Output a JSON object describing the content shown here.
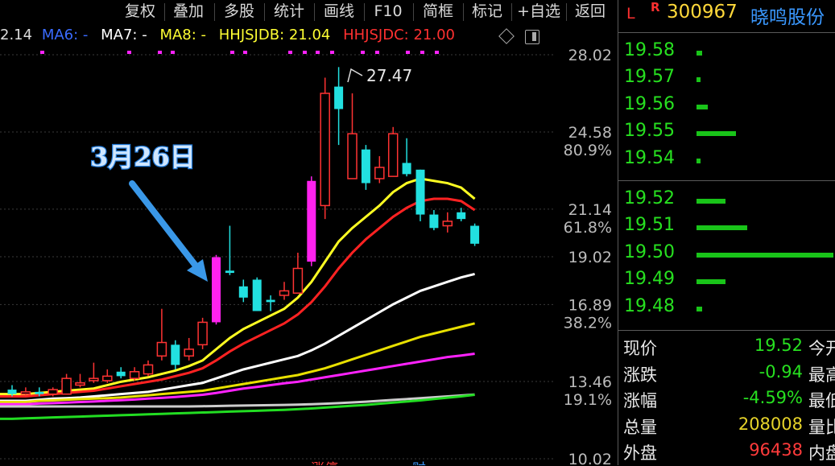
{
  "toolbar": {
    "buttons": [
      "复权",
      "叠加",
      "多股",
      "统计",
      "画线",
      "F10",
      "简框",
      "标记",
      "+自选",
      "返回"
    ]
  },
  "indicator_line": {
    "first_value": "2.14",
    "ma6": "MA6: -",
    "ma7": "MA7: -",
    "ma8": "MA8: -",
    "hhjsjdb": "HHJSJDB: 21.04",
    "hhjsjdc": "HHJSJDC: 21.00"
  },
  "stock": {
    "tag_l": "L",
    "tag_r": "R",
    "code": "300967",
    "name": "晓鸣股份"
  },
  "price_axis": {
    "prices": [
      "28.02",
      "24.58",
      "21.14",
      "19.02",
      "16.89",
      "13.46",
      "10.02"
    ],
    "percents": [
      "80.9%",
      "61.8%",
      "38.2%",
      "19.1%"
    ]
  },
  "annotation": {
    "date_label": "3月26日",
    "high_label": "27.47"
  },
  "bottom_marks": [
    "涨停",
    "财"
  ],
  "order_book": {
    "asks": [
      {
        "price": "19.58",
        "level": 0.04
      },
      {
        "price": "19.57",
        "level": 0.03
      },
      {
        "price": "19.56",
        "level": 0.08
      },
      {
        "price": "19.55",
        "level": 0.29
      },
      {
        "price": "19.54",
        "level": 0.02
      }
    ],
    "bids": [
      {
        "price": "19.52",
        "level": 0.21
      },
      {
        "price": "19.51",
        "level": 0.37
      },
      {
        "price": "19.50",
        "level": 1.0
      },
      {
        "price": "19.49",
        "level": 0.21
      },
      {
        "price": "19.48",
        "level": 0.04
      }
    ]
  },
  "quote": [
    {
      "label": "现价",
      "value": "19.52",
      "color": "#27e020",
      "label2": "今开"
    },
    {
      "label": "涨跌",
      "value": "-0.94",
      "color": "#27e020",
      "label2": "最高"
    },
    {
      "label": "涨幅",
      "value": "-4.59%",
      "color": "#27e020",
      "label2": "最低"
    },
    {
      "label": "总量",
      "value": "208008",
      "color": "#e6d32a",
      "label2": "量比"
    },
    {
      "label": "外盘",
      "value": "96438",
      "color": "#ff3b3b",
      "label2": "内盘"
    }
  ],
  "chart_data": {
    "type": "candlestick",
    "price_range": [
      10.02,
      28.02
    ],
    "candles": [
      {
        "o": 13.1,
        "c": 12.9,
        "h": 13.3,
        "l": 12.8,
        "up": false
      },
      {
        "o": 12.9,
        "c": 13.0,
        "h": 13.2,
        "l": 12.8,
        "up": true
      },
      {
        "o": 12.9,
        "c": 13.0,
        "h": 13.2,
        "l": 12.8,
        "up": false
      },
      {
        "o": 12.9,
        "c": 13.1,
        "h": 13.2,
        "l": 12.8,
        "up": true
      },
      {
        "o": 12.9,
        "c": 13.6,
        "h": 13.8,
        "l": 12.9,
        "up": true
      },
      {
        "o": 13.3,
        "c": 13.4,
        "h": 13.8,
        "l": 13.2,
        "up": true
      },
      {
        "o": 13.5,
        "c": 13.6,
        "h": 14.3,
        "l": 13.4,
        "up": true
      },
      {
        "o": 13.5,
        "c": 13.7,
        "h": 14.0,
        "l": 13.4,
        "up": true
      },
      {
        "o": 13.7,
        "c": 13.9,
        "h": 14.1,
        "l": 13.6,
        "up": false
      },
      {
        "o": 13.6,
        "c": 13.9,
        "h": 14.1,
        "l": 13.5,
        "up": true
      },
      {
        "o": 13.8,
        "c": 14.2,
        "h": 14.4,
        "l": 13.7,
        "up": true
      },
      {
        "o": 14.6,
        "c": 15.2,
        "h": 16.7,
        "l": 14.4,
        "up": true
      },
      {
        "o": 14.2,
        "c": 15.1,
        "h": 15.3,
        "l": 14.0,
        "up": false
      },
      {
        "o": 14.6,
        "c": 14.9,
        "h": 15.4,
        "l": 14.4,
        "up": true
      },
      {
        "o": 15.1,
        "c": 16.1,
        "h": 16.3,
        "l": 14.9,
        "up": true
      },
      {
        "o": 16.1,
        "c": 19.0,
        "h": 19.1,
        "l": 16.0,
        "up": true,
        "limit": true
      },
      {
        "o": 18.4,
        "c": 18.3,
        "h": 20.4,
        "l": 18.2,
        "up": false
      },
      {
        "o": 17.7,
        "c": 17.2,
        "h": 18.0,
        "l": 17.0,
        "up": false
      },
      {
        "o": 18.0,
        "c": 16.6,
        "h": 18.1,
        "l": 16.6,
        "up": false
      },
      {
        "o": 17.1,
        "c": 17.0,
        "h": 17.3,
        "l": 16.6,
        "up": false
      },
      {
        "o": 17.3,
        "c": 17.5,
        "h": 17.9,
        "l": 17.1,
        "up": true
      },
      {
        "o": 17.4,
        "c": 18.5,
        "h": 19.2,
        "l": 17.4,
        "up": true
      },
      {
        "o": 18.8,
        "c": 22.4,
        "h": 22.6,
        "l": 18.6,
        "up": true,
        "limit": true
      },
      {
        "o": 21.3,
        "c": 26.3,
        "h": 27.0,
        "l": 20.7,
        "up": true
      },
      {
        "o": 25.6,
        "c": 26.6,
        "h": 27.47,
        "l": 24.0,
        "up": false
      },
      {
        "o": 24.5,
        "c": 22.5,
        "h": 26.3,
        "l": 22.5,
        "up": true
      },
      {
        "o": 23.8,
        "c": 22.3,
        "h": 24.0,
        "l": 22.0,
        "up": false
      },
      {
        "o": 22.5,
        "c": 23.0,
        "h": 23.5,
        "l": 22.3,
        "up": true
      },
      {
        "o": 22.6,
        "c": 24.5,
        "h": 24.8,
        "l": 22.6,
        "up": true
      },
      {
        "o": 23.2,
        "c": 22.7,
        "h": 24.3,
        "l": 22.6,
        "up": false
      },
      {
        "o": 22.9,
        "c": 20.9,
        "h": 22.9,
        "l": 20.6,
        "up": false
      },
      {
        "o": 20.9,
        "c": 20.3,
        "h": 21.1,
        "l": 20.2,
        "up": false
      },
      {
        "o": 20.6,
        "c": 20.4,
        "h": 21.0,
        "l": 20.1,
        "up": true
      },
      {
        "o": 21.0,
        "c": 20.7,
        "h": 21.2,
        "l": 20.6,
        "up": false
      },
      {
        "o": 20.4,
        "c": 19.6,
        "h": 20.5,
        "l": 19.5,
        "up": false
      }
    ],
    "ma_lines": [
      {
        "color": "#ffff22",
        "points": [
          12.9,
          12.9,
          12.95,
          13.0,
          13.05,
          13.1,
          13.15,
          13.3,
          13.45,
          13.55,
          13.65,
          13.8,
          13.95,
          14.15,
          14.4,
          14.9,
          15.4,
          15.8,
          16.1,
          16.4,
          16.7,
          17.2,
          17.9,
          18.8,
          19.7,
          20.3,
          20.8,
          21.3,
          21.9,
          22.3,
          22.5,
          22.4,
          22.3,
          22.1,
          21.6
        ]
      },
      {
        "color": "#ff2222",
        "points": [
          12.8,
          12.8,
          12.85,
          12.9,
          12.95,
          13.0,
          13.05,
          13.15,
          13.25,
          13.35,
          13.45,
          13.55,
          13.7,
          13.85,
          14.05,
          14.4,
          14.8,
          15.15,
          15.45,
          15.75,
          16.05,
          16.45,
          17.0,
          17.7,
          18.5,
          19.2,
          19.8,
          20.3,
          20.8,
          21.2,
          21.5,
          21.6,
          21.6,
          21.5,
          21.1
        ]
      },
      {
        "color": "#ffffff",
        "points": [
          12.6,
          12.6,
          12.65,
          12.7,
          12.72,
          12.75,
          12.8,
          12.85,
          12.9,
          12.95,
          13.0,
          13.1,
          13.2,
          13.3,
          13.4,
          13.6,
          13.8,
          14.0,
          14.15,
          14.3,
          14.45,
          14.6,
          14.85,
          15.15,
          15.5,
          15.85,
          16.2,
          16.55,
          16.9,
          17.2,
          17.5,
          17.7,
          17.9,
          18.1,
          18.25
        ]
      },
      {
        "color": "#e8e000",
        "points": [
          12.55,
          12.55,
          12.6,
          12.62,
          12.65,
          12.68,
          12.7,
          12.72,
          12.75,
          12.8,
          12.85,
          12.9,
          12.95,
          13.0,
          13.05,
          13.15,
          13.25,
          13.35,
          13.45,
          13.55,
          13.65,
          13.75,
          13.9,
          14.05,
          14.25,
          14.45,
          14.65,
          14.85,
          15.05,
          15.25,
          15.45,
          15.6,
          15.75,
          15.9,
          16.05
        ]
      },
      {
        "color": "#ff22ff",
        "points": [
          12.45,
          12.45,
          12.48,
          12.5,
          12.52,
          12.55,
          12.57,
          12.6,
          12.63,
          12.66,
          12.7,
          12.73,
          12.77,
          12.82,
          12.87,
          12.95,
          13.05,
          13.15,
          13.22,
          13.3,
          13.38,
          13.45,
          13.55,
          13.65,
          13.75,
          13.85,
          13.95,
          14.05,
          14.15,
          14.25,
          14.35,
          14.45,
          14.55,
          14.62,
          14.7
        ]
      },
      {
        "color": "#cccccc",
        "points": [
          12.35,
          12.35,
          12.35,
          12.35,
          12.35,
          12.35,
          12.35,
          12.35,
          12.35,
          12.35,
          12.35,
          12.35,
          12.35,
          12.35,
          12.36,
          12.37,
          12.38,
          12.39,
          12.4,
          12.41,
          12.42,
          12.43,
          12.45,
          12.47,
          12.5,
          12.53,
          12.56,
          12.6,
          12.64,
          12.68,
          12.72,
          12.76,
          12.8,
          12.84,
          12.88
        ]
      },
      {
        "color": "#22dd22",
        "points": [
          11.8,
          11.82,
          11.84,
          11.86,
          11.88,
          11.9,
          11.92,
          11.94,
          11.96,
          11.98,
          12.0,
          12.02,
          12.04,
          12.06,
          12.08,
          12.1,
          12.12,
          12.14,
          12.16,
          12.18,
          12.2,
          12.23,
          12.26,
          12.3,
          12.34,
          12.38,
          12.42,
          12.47,
          12.52,
          12.57,
          12.62,
          12.68,
          12.74,
          12.8,
          12.87
        ]
      }
    ]
  }
}
